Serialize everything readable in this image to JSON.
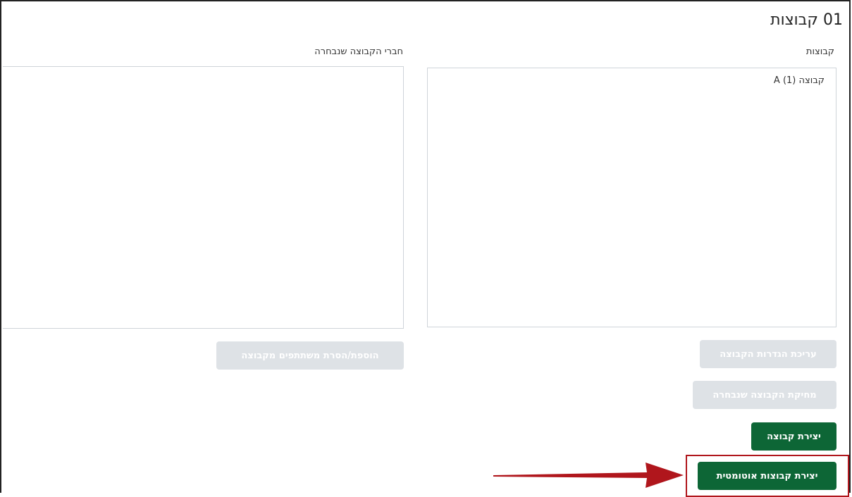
{
  "page": {
    "title": "01 קבוצות"
  },
  "groups_panel": {
    "label": "קבוצות",
    "options": [
      "קבוצה A (1)"
    ]
  },
  "members_panel": {
    "label": "חברי הקבוצה שנבחרה"
  },
  "buttons": {
    "edit_group": "עריכת הגדרות הקבוצה",
    "delete_group": "מחיקת הקבוצה שנבחרה",
    "create_group": "יצירת קבוצה",
    "auto_create": "יצירת קבוצות אוטומטית",
    "add_remove_members": "הוספת/הסרת משתתפים מקבוצה"
  },
  "colors": {
    "primary_button": "#0d6636",
    "disabled_button": "#dee2e6",
    "annotation": "#b0161c"
  },
  "annotation": {
    "arrow_icon": "right-arrow-icon",
    "highlight": "highlight-box"
  }
}
